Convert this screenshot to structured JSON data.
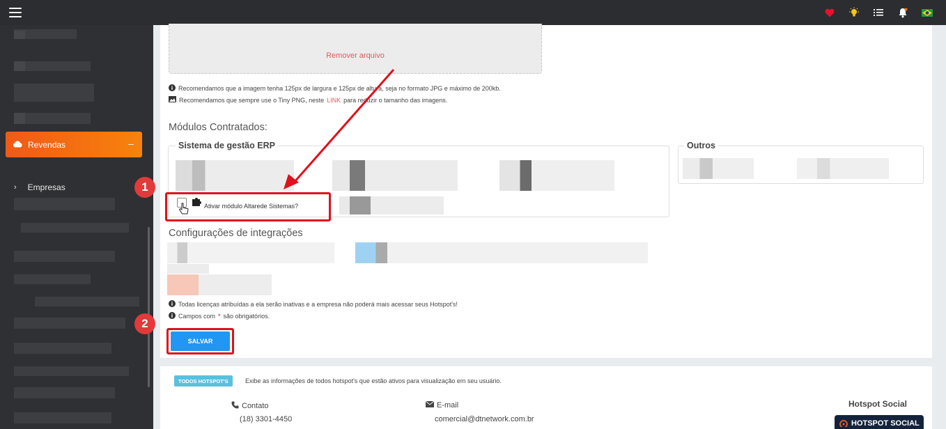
{
  "topbar": {
    "icons": [
      "heart-icon",
      "lightbulb-icon",
      "list-icon",
      "bell-icon",
      "brazil-flag-icon"
    ],
    "colors": {
      "heart": "#e8102c",
      "bulb": "#f5c518"
    }
  },
  "sidebar": {
    "active_item": "Revendas",
    "sub_item": "Empresas",
    "accent": "#f07018"
  },
  "upload": {
    "remove_label": "Remover arquivo"
  },
  "notes": {
    "image_size": "Recomendamos que a imagem tenha 125px de largura e 125px de altura, seja no formato JPG e máximo de 200kb.",
    "tiny_png_before": "Recomendamos que sempre use o Tiny PNG, neste",
    "tiny_png_link": "LINK",
    "tiny_png_after": "para reduzir o tamanho das imagens."
  },
  "modules": {
    "title": "Módulos Contratados:",
    "erp_legend": "Sistema de gestão ERP",
    "others_legend": "Outros",
    "altarede_label": "Ativar módulo Altarede Sistemas?"
  },
  "integrations": {
    "title": "Configurações de integrações"
  },
  "footer_notes": {
    "licenses": "Todas licenças atribuídas a ela serão inativas e a empresa não poderá mais acessar seus Hotspot's!",
    "required_before": "Campos com",
    "required_star": "*",
    "required_after": "são obrigatórios."
  },
  "save_button": "SALVAR",
  "annotations": {
    "step1": "1",
    "step2": "2",
    "color": "#e0101c"
  },
  "hotspots": {
    "tag": "TODOS HOTSPOT'S",
    "description": "Exibe as informações de todos hotspot's que estão ativos para visualização em seu usuário.",
    "contact_label": "Contato",
    "contact_value": "(18) 3301-4450",
    "email_label": "E-mail",
    "email_value": "comercial@dtnetwork.com.br",
    "brand_title": "Hotspot Social",
    "brand_logo": "HOTSPOT SOCIAL"
  }
}
